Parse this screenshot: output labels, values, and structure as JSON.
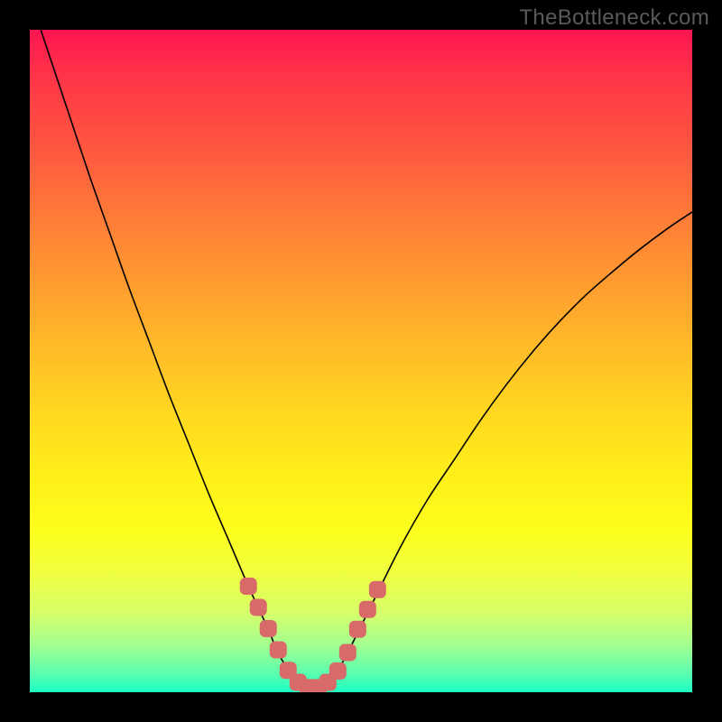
{
  "watermark": "TheBottleneck.com",
  "chart_data": {
    "type": "line",
    "title": "",
    "xlabel": "",
    "ylabel": "",
    "xlim": [
      0,
      100
    ],
    "ylim": [
      0,
      100
    ],
    "series": [
      {
        "name": "bottleneck-curve",
        "x": [
          0,
          3,
          6,
          9,
          12,
          15,
          18,
          21,
          24,
          27,
          30,
          33,
          36,
          37,
          38,
          40,
          42,
          43,
          44,
          46,
          48,
          52,
          56,
          60,
          64,
          68,
          72,
          76,
          80,
          84,
          88,
          92,
          96,
          100
        ],
        "values": [
          105,
          96,
          87,
          78,
          69.5,
          61,
          53,
          45,
          37.5,
          30,
          23,
          16,
          9.5,
          7,
          5,
          2,
          0.5,
          0.5,
          0.5,
          2.5,
          6,
          14,
          22,
          29,
          35,
          41,
          46.5,
          51.5,
          56,
          60,
          63.5,
          66.8,
          69.8,
          72.5
        ]
      }
    ],
    "markers": {
      "name": "highlight-band",
      "color": "#d86a6a",
      "points": [
        {
          "x": 33.0,
          "y": 16.0
        },
        {
          "x": 34.5,
          "y": 12.8
        },
        {
          "x": 36.0,
          "y": 9.6
        },
        {
          "x": 37.5,
          "y": 6.4
        },
        {
          "x": 39.0,
          "y": 3.3
        },
        {
          "x": 40.5,
          "y": 1.5
        },
        {
          "x": 42.0,
          "y": 0.7
        },
        {
          "x": 43.5,
          "y": 0.7
        },
        {
          "x": 45.0,
          "y": 1.5
        },
        {
          "x": 46.5,
          "y": 3.2
        },
        {
          "x": 48.0,
          "y": 6.0
        },
        {
          "x": 49.5,
          "y": 9.5
        },
        {
          "x": 51.0,
          "y": 12.5
        },
        {
          "x": 52.5,
          "y": 15.5
        }
      ]
    },
    "background_gradient": {
      "orientation": "vertical",
      "stops": [
        {
          "pos": 0,
          "color": "#ff1450"
        },
        {
          "pos": 50,
          "color": "#ffc225"
        },
        {
          "pos": 80,
          "color": "#f8ff30"
        },
        {
          "pos": 100,
          "color": "#1affc4"
        }
      ]
    }
  }
}
